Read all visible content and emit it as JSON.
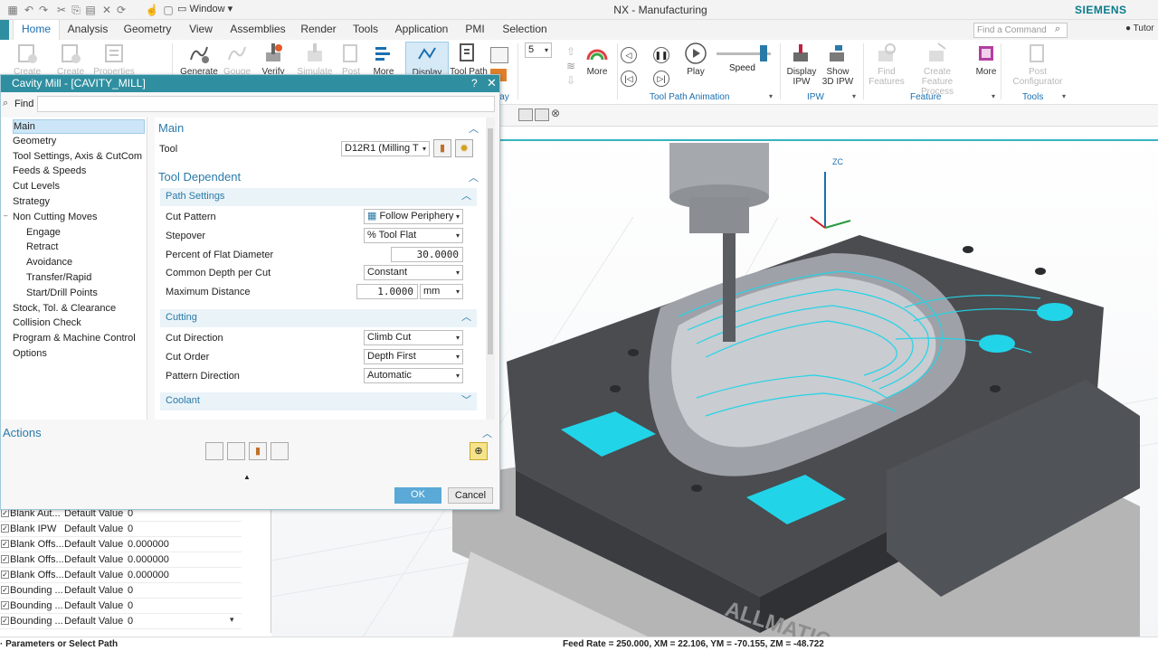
{
  "app": {
    "title": "NX - Manufacturing",
    "brand": "SIEMENS",
    "window_menu": "Window",
    "tutorial": "Tutor"
  },
  "tabs": [
    {
      "label": "Home"
    },
    {
      "label": "Analysis"
    },
    {
      "label": "Geometry"
    },
    {
      "label": "View"
    },
    {
      "label": "Assemblies"
    },
    {
      "label": "Render"
    },
    {
      "label": "Tools"
    },
    {
      "label": "Application"
    },
    {
      "label": "PMI"
    },
    {
      "label": "Selection"
    }
  ],
  "command_search": {
    "placeholder": "Find a Command"
  },
  "ribbon": {
    "buttons": [
      {
        "label": "Create",
        "disabled": true
      },
      {
        "label": "Create",
        "disabled": true
      },
      {
        "label": "Properties",
        "disabled": true
      },
      {
        "label": "Generate",
        "disabled": false
      },
      {
        "label": "Gouge",
        "disabled": true
      },
      {
        "label": "Verify",
        "disabled": false
      },
      {
        "label": "Simulate",
        "disabled": true
      },
      {
        "label": "Post",
        "disabled": true
      },
      {
        "label": "More",
        "disabled": false
      },
      {
        "label": "Display",
        "disabled": false
      },
      {
        "label": "Tool Path",
        "disabled": false
      }
    ],
    "speed_value": "5",
    "more_label": "More",
    "play_label": "Play",
    "speed_label": "Speed",
    "display_ipw": "Display IPW",
    "show_3d_ipw": "Show 3D IPW",
    "find_features": "Find Features",
    "create_feature_process": "Create Feature Process",
    "more2_label": "More",
    "post_configurator": "Post Configurator",
    "groups": {
      "display": "lay",
      "animation": "Tool Path Animation",
      "ipw": "IPW",
      "feature": "Feature",
      "tools": "Tools"
    }
  },
  "dialog": {
    "title": "Cavity Mill - [CAVITY_MILL]",
    "help": "?",
    "close": "✕",
    "find_label": "Find",
    "nav": [
      {
        "label": "Main",
        "selected": true,
        "indent": 0
      },
      {
        "label": "Geometry",
        "selected": false,
        "indent": 0
      },
      {
        "label": "Tool Settings, Axis & CutCom",
        "selected": false,
        "indent": 0
      },
      {
        "label": "Feeds & Speeds",
        "selected": false,
        "indent": 0
      },
      {
        "label": "Cut Levels",
        "selected": false,
        "indent": 0
      },
      {
        "label": "Strategy",
        "selected": false,
        "indent": 0
      },
      {
        "label": "Non Cutting Moves",
        "selected": false,
        "indent": 0
      },
      {
        "label": "Engage",
        "selected": false,
        "indent": 1
      },
      {
        "label": "Retract",
        "selected": false,
        "indent": 1
      },
      {
        "label": "Avoidance",
        "selected": false,
        "indent": 1
      },
      {
        "label": "Transfer/Rapid",
        "selected": false,
        "indent": 1
      },
      {
        "label": "Start/Drill Points",
        "selected": false,
        "indent": 1
      },
      {
        "label": "Stock, Tol. & Clearance",
        "selected": false,
        "indent": 0
      },
      {
        "label": "Collision Check",
        "selected": false,
        "indent": 0
      },
      {
        "label": "Program & Machine Control",
        "selected": false,
        "indent": 0
      },
      {
        "label": "Options",
        "selected": false,
        "indent": 0
      }
    ],
    "main_section": "Main",
    "tool_label": "Tool",
    "tool_value": "D12R1 (Milling T",
    "tool_dependent": "Tool Dependent",
    "path_settings": "Path Settings",
    "cut_pattern_label": "Cut Pattern",
    "cut_pattern_value": "Follow Periphery",
    "stepover_label": "Stepover",
    "stepover_value": "% Tool Flat",
    "pct_flat_label": "Percent of Flat Diameter",
    "pct_flat_value": "30.0000",
    "common_depth_label": "Common Depth per Cut",
    "common_depth_value": "Constant",
    "max_distance_label": "Maximum Distance",
    "max_distance_value": "1.0000",
    "max_distance_unit": "mm",
    "cutting": "Cutting",
    "cut_direction_label": "Cut Direction",
    "cut_direction_value": "Climb Cut",
    "cut_order_label": "Cut Order",
    "cut_order_value": "Depth First",
    "pattern_direction_label": "Pattern Direction",
    "pattern_direction_value": "Automatic",
    "coolant": "Coolant",
    "actions": "Actions",
    "ok": "OK",
    "cancel": "Cancel"
  },
  "param_table": [
    {
      "name": "Blank Aut...",
      "type": "Default Value",
      "value": "0"
    },
    {
      "name": "Blank IPW",
      "type": "Default Value",
      "value": "0"
    },
    {
      "name": "Blank Offs...",
      "type": "Default Value",
      "value": "0.000000"
    },
    {
      "name": "Blank Offs...",
      "type": "Default Value",
      "value": "0.000000"
    },
    {
      "name": "Blank Offs...",
      "type": "Default Value",
      "value": "0.000000"
    },
    {
      "name": "Bounding ...",
      "type": "Default Value",
      "value": "0"
    },
    {
      "name": "Bounding ...",
      "type": "Default Value",
      "value": "0"
    },
    {
      "name": "Bounding ...",
      "type": "Default Value",
      "value": "0"
    }
  ],
  "viewport": {
    "axis_label": "ZC",
    "vise_brand": "ALLMATIC"
  },
  "status": {
    "left": "· Parameters or Select Path",
    "right": "Feed Rate = 250.000, XM = 22.106, YM = -70.155, ZM = -48.722"
  },
  "colors": {
    "accent": "#2f8fa0",
    "link_blue": "#2a7aa8",
    "toolpath": "#22d4e8",
    "brand": "#0a7b8c"
  }
}
